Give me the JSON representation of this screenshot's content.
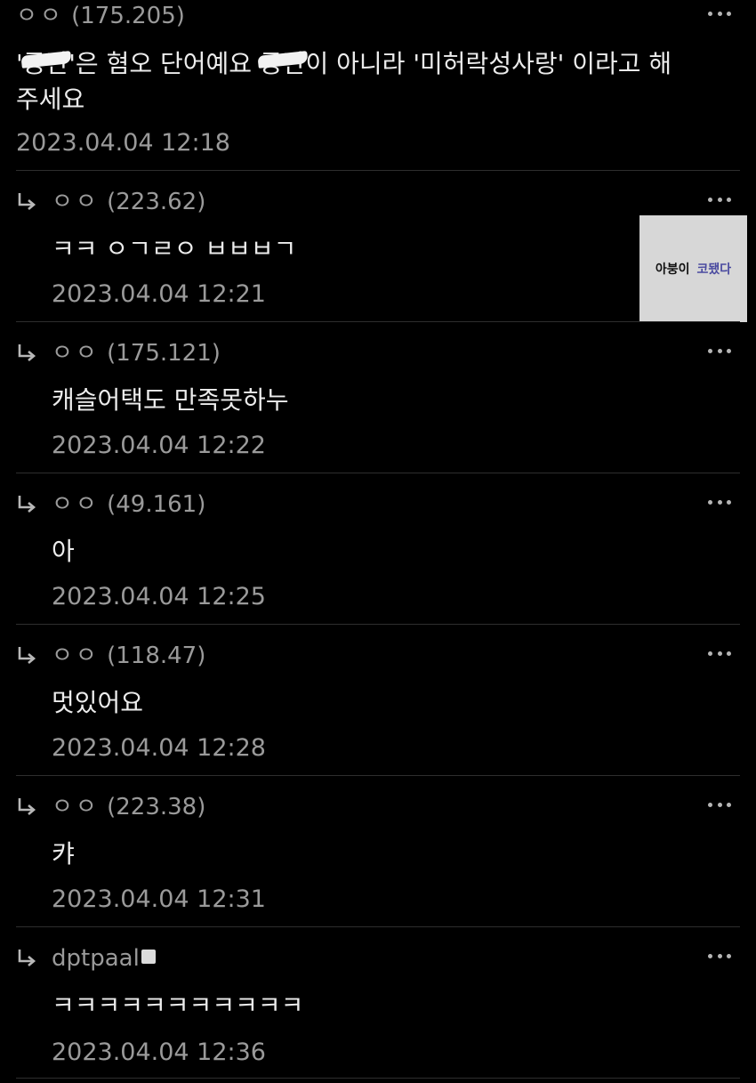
{
  "comments": [
    {
      "author": "ㅇㅇ",
      "ip": "(175.205)",
      "body_q1": "'",
      "body_redacted1": "공간",
      "body_q2": "'은 혐오 단어예요 ",
      "body_redacted2": "공간",
      "body_rest": "이 아니라 '미허락성사랑' 이라고 해",
      "body_line2": "주세요",
      "date": "2023.04.04 12:18"
    },
    {
      "author": "ㅇㅇ",
      "ip": "(223.62)",
      "body": "ㅋㅋ ㅇㄱㄹㅇ ㅂㅂㅂㄱ",
      "date": "2023.04.04 12:21",
      "thumb_text1": "아붕이",
      "thumb_text2": "코됐다"
    },
    {
      "author": "ㅇㅇ",
      "ip": "(175.121)",
      "body": "캐슬어택도 만족못하누",
      "date": "2023.04.04 12:22"
    },
    {
      "author": "ㅇㅇ",
      "ip": "(49.161)",
      "body": "아",
      "date": "2023.04.04 12:25"
    },
    {
      "author": "ㅇㅇ",
      "ip": "(118.47)",
      "body": "멋있어요",
      "date": "2023.04.04 12:28"
    },
    {
      "author": "ㅇㅇ",
      "ip": "(223.38)",
      "body": "캬",
      "date": "2023.04.04 12:31"
    },
    {
      "author": "dptpaal",
      "body": "ㅋㅋㅋㅋㅋㅋㅋㅋㅋㅋㅋ",
      "date": "2023.04.04 12:36"
    }
  ],
  "icons": {
    "reply": "reply-arrow-icon",
    "more": "more-horizontal-icon",
    "badge": "user-badge-icon"
  },
  "colors": {
    "background": "#000000",
    "text_primary": "#ececec",
    "text_secondary": "#9a9a9a",
    "divider": "#2e2e2e"
  }
}
